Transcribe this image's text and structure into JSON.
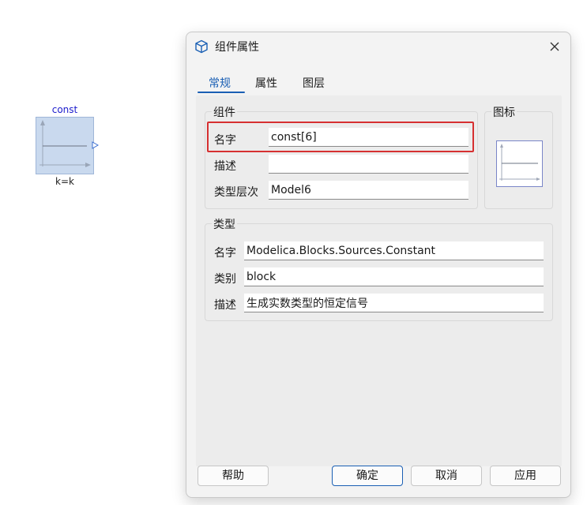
{
  "canvas": {
    "block": {
      "name": "const",
      "param": "k=k"
    }
  },
  "dialog": {
    "title": "组件属性",
    "title_icon": "cube-icon",
    "close_icon": "close-icon",
    "tabs": [
      {
        "label": "常规",
        "active": true
      },
      {
        "label": "属性",
        "active": false
      },
      {
        "label": "图层",
        "active": false
      }
    ],
    "component_group": {
      "title": "组件",
      "rows": [
        {
          "label": "名字",
          "value": "const[6]"
        },
        {
          "label": "描述",
          "value": ""
        },
        {
          "label": "类型层次",
          "value": "Model6"
        }
      ]
    },
    "icon_group": {
      "title": "图标"
    },
    "type_group": {
      "title": "类型",
      "rows": [
        {
          "label": "名字",
          "value": "Modelica.Blocks.Sources.Constant"
        },
        {
          "label": "类别",
          "value": "block"
        },
        {
          "label": "描述",
          "value": "生成实数类型的恒定信号"
        }
      ]
    },
    "buttons": {
      "help": "帮助",
      "ok": "确定",
      "cancel": "取消",
      "apply": "应用"
    },
    "colors": {
      "accent": "#1a5fb4",
      "highlight": "#d63031",
      "block_fill": "#c9d9ee"
    }
  }
}
